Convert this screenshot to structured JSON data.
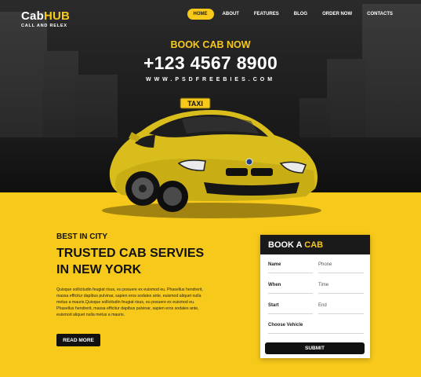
{
  "brand": {
    "name_part1": "Cab",
    "name_part2": "HUB",
    "tagline": "CALL AND RELEX"
  },
  "nav": {
    "items": [
      {
        "label": "HOME",
        "active": true
      },
      {
        "label": "ABOUT",
        "active": false
      },
      {
        "label": "FEATURES",
        "active": false
      },
      {
        "label": "BLOG",
        "active": false
      },
      {
        "label": "ORDER NOW",
        "active": false
      },
      {
        "label": "CONTACTS",
        "active": false
      }
    ]
  },
  "hero": {
    "book_label": "BOOK CAB NOW",
    "phone": "+123 4567 8900",
    "website": "WWW.PSDFREEBIES.COM",
    "taxi_sign": "TAXI"
  },
  "intro": {
    "eyebrow": "BEST IN CITY",
    "headline_line1": "TRUSTED CAB SERVIES",
    "headline_line2": "IN NEW YORK",
    "body": "Quisque sollicitudin feugiat risus, eu posuere ex euismod eu. Phasellus hendrerit, massa efficitur dapibus pulvinar, sapien eros sodales ante, euismod aliquet nulla metus a mauris.Quisque sollicitudin feugiat risus, eu posuere ex euismod eu. Phasellus hendrerit, massa efficitur dapibus pulvinar, sapien eros sodales ante, euismod aliquet nulla metus a mauris.",
    "read_more": "READ MORE"
  },
  "booking": {
    "title_part1": "BOOK A",
    "title_part2": "CAB",
    "fields": {
      "name": "Name",
      "phone": "Phone",
      "when": "When",
      "time": "Time",
      "start": "Start",
      "end": "End",
      "vehicle": "Choose Vehicle"
    },
    "submit": "SUBMIT"
  },
  "colors": {
    "accent": "#f7c91b",
    "dark": "#1a1a1a"
  }
}
